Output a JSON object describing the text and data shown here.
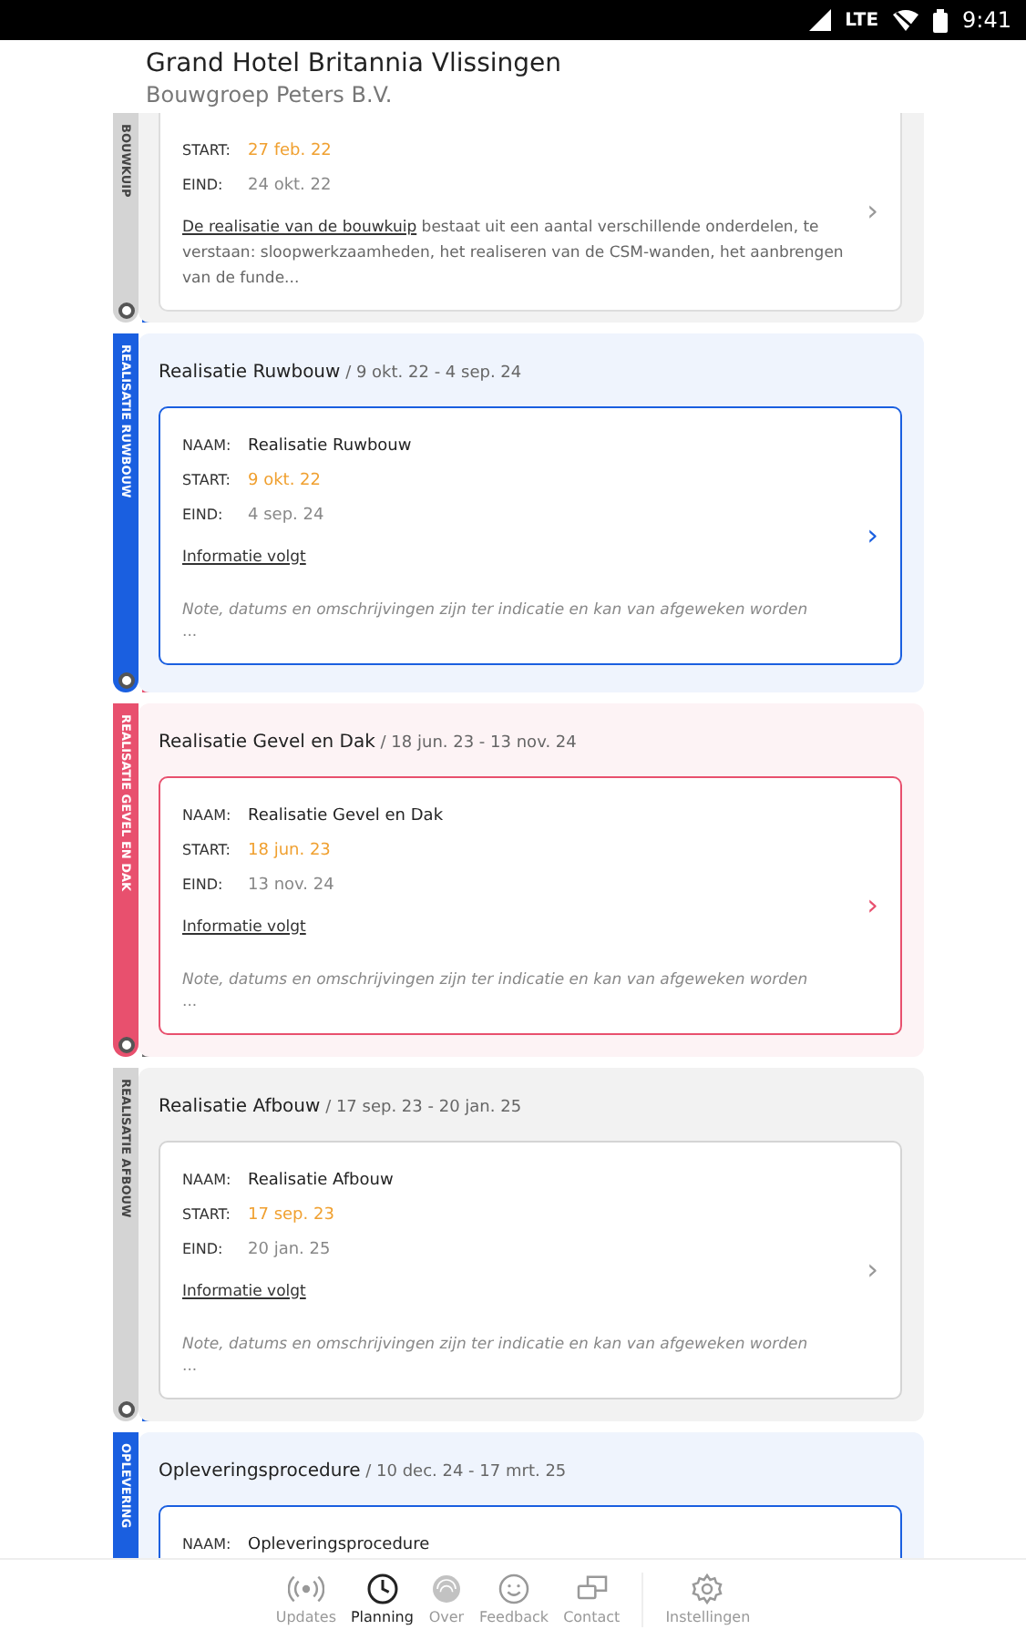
{
  "status_bar": {
    "network": "LTE",
    "time": "9:41"
  },
  "header": {
    "title": "Grand Hotel Britannia Vlissingen",
    "subtitle": "Bouwgroep Peters B.V."
  },
  "phases": [
    {
      "rail_label": "BOUWKUIP",
      "color": "#d4d4d4",
      "card": {
        "fields": [
          {
            "label": "START:",
            "value": "27 feb. 22",
            "kind": "start"
          },
          {
            "label": "EIND:",
            "value": "24 okt. 22",
            "kind": "end"
          }
        ],
        "link": "De realisatie van de bouwkuip",
        "text": " bestaat uit een aantal verschillende onderdelen, te verstaan: sloopwerkzaamheden, het realiseren van de CSM-wanden, het aanbrengen van de funde..."
      },
      "chevron": "›"
    },
    {
      "title": "Realisatie Ruwbouw",
      "dates": " / 9 okt. 22 - 4 sep. 24",
      "rail_label": "REALISATIE RUWBOUW",
      "color": "#1a5fe0",
      "card": {
        "fields": [
          {
            "label": "NAAM:",
            "value": "Realisatie Ruwbouw",
            "kind": "name"
          },
          {
            "label": "START:",
            "value": "9 okt. 22",
            "kind": "start"
          },
          {
            "label": "EIND:",
            "value": "4 sep. 24",
            "kind": "end"
          }
        ],
        "info": "Informatie volgt",
        "note": "Note, datums en omschrijvingen zijn ter indicatie en kan van afgeweken worden",
        "more": "..."
      },
      "chevron": "›"
    },
    {
      "title": "Realisatie Gevel en Dak",
      "dates": " / 18 jun. 23 - 13 nov. 24",
      "rail_label": "REALISATIE GEVEL EN DAK",
      "color": "#e8506e",
      "card": {
        "fields": [
          {
            "label": "NAAM:",
            "value": "Realisatie Gevel en Dak",
            "kind": "name"
          },
          {
            "label": "START:",
            "value": "18 jun. 23",
            "kind": "start"
          },
          {
            "label": "EIND:",
            "value": "13 nov. 24",
            "kind": "end"
          }
        ],
        "info": "Informatie volgt",
        "note": "Note, datums en omschrijvingen zijn ter indicatie en kan van afgeweken worden",
        "more": "..."
      },
      "chevron": "›"
    },
    {
      "title": "Realisatie Afbouw",
      "dates": " / 17 sep. 23 - 20 jan. 25",
      "rail_label": "REALISATIE AFBOUW",
      "color": "#d4d4d4",
      "card": {
        "fields": [
          {
            "label": "NAAM:",
            "value": "Realisatie Afbouw",
            "kind": "name"
          },
          {
            "label": "START:",
            "value": "17 sep. 23",
            "kind": "start"
          },
          {
            "label": "EIND:",
            "value": "20 jan. 25",
            "kind": "end"
          }
        ],
        "info": "Informatie volgt",
        "note": "Note, datums en omschrijvingen zijn ter indicatie en kan van afgeweken worden",
        "more": "..."
      },
      "chevron": "›"
    },
    {
      "title": "Opleveringsprocedure",
      "dates": " / 10 dec. 24 - 17 mrt. 25",
      "rail_label": "OPLEVERING",
      "color": "#1a5fe0",
      "card": {
        "fields": [
          {
            "label": "NAAM:",
            "value": "Opleveringsprocedure",
            "kind": "name"
          }
        ]
      }
    }
  ],
  "nav": [
    {
      "label": "Updates",
      "selected": false
    },
    {
      "label": "Planning",
      "selected": true
    },
    {
      "label": "Over",
      "selected": false
    },
    {
      "label": "Feedback",
      "selected": false
    },
    {
      "label": "Contact",
      "selected": false
    },
    {
      "label": "Instellingen",
      "selected": false,
      "separated": true
    }
  ]
}
